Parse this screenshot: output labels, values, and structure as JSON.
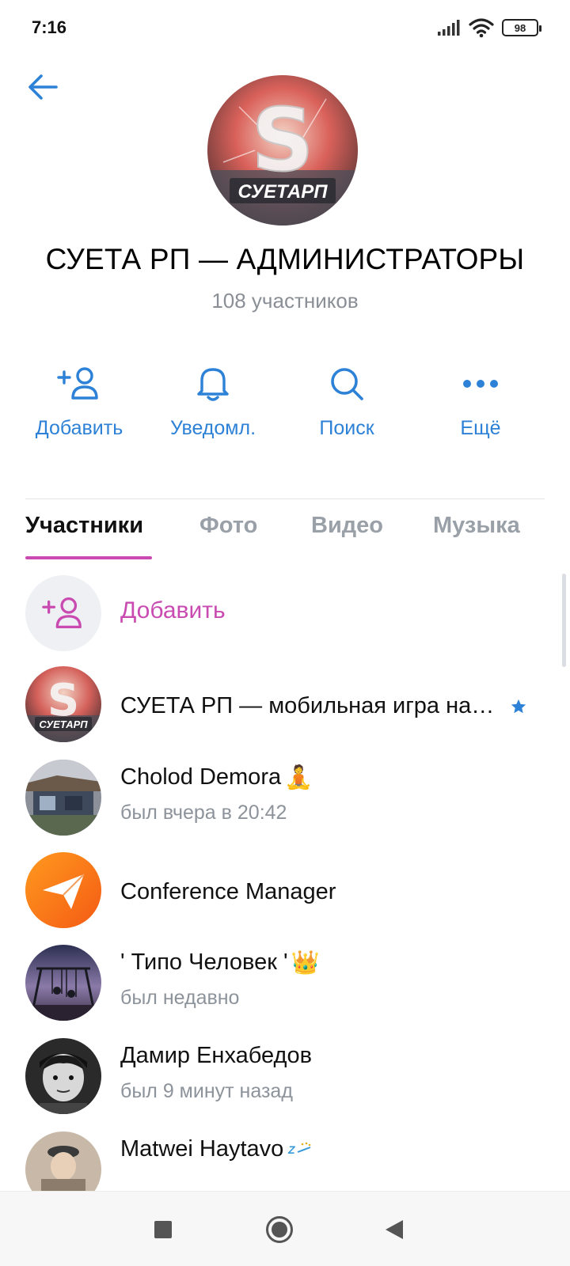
{
  "status_bar": {
    "time": "7:16",
    "battery": "98",
    "icons": [
      "signal-icon",
      "wifi-icon",
      "battery-icon"
    ]
  },
  "header": {
    "back_icon": "arrow-left-icon",
    "avatar_text": "СУЕТАРП",
    "title": "СУЕТА РП — АДМИНИСТРАТОРЫ",
    "subtitle": "108 участников"
  },
  "actions": [
    {
      "label": "Добавить",
      "icon": "add-user-icon"
    },
    {
      "label": "Уведомл.",
      "icon": "bell-icon"
    },
    {
      "label": "Поиск",
      "icon": "search-icon"
    },
    {
      "label": "Ещё",
      "icon": "more-icon"
    }
  ],
  "tabs": [
    {
      "label": "Участники",
      "active": true
    },
    {
      "label": "Фото",
      "active": false
    },
    {
      "label": "Видео",
      "active": false
    },
    {
      "label": "Музыка",
      "active": false
    }
  ],
  "members": {
    "add_label": "Добавить",
    "items": [
      {
        "name": "СУЕТА РП — мобильная игра на…",
        "status": "",
        "avatar_text": "СУЕТАРП",
        "badge": "star-icon"
      },
      {
        "name": "Cholod Demora",
        "status": "был вчера в 20:42",
        "emoji": "🧘"
      },
      {
        "name": "Conference Manager",
        "status": ""
      },
      {
        "name": "' Типо Человек '",
        "status": "был недавно",
        "emoji": "👑"
      },
      {
        "name": "Дамир Енхабедов",
        "status": "был 9 минут назад"
      },
      {
        "name": "Matwei Haytavo",
        "status": ""
      }
    ]
  },
  "colors": {
    "accent_blue": "#2d81d6",
    "accent_pink": "#c94bb1",
    "muted": "#8d939a"
  },
  "nav_bar": {
    "icons": [
      "recents-square-icon",
      "home-circle-icon",
      "back-triangle-icon"
    ]
  }
}
